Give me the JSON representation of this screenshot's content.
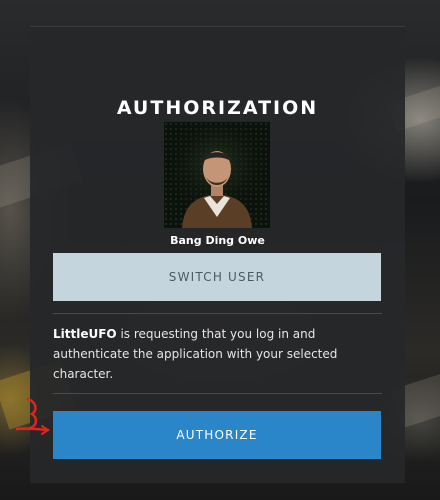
{
  "panel": {
    "title": "AUTHORIZATION",
    "character": {
      "name": "Bang Ding Owe"
    },
    "switch_user_label": "SWITCH USER",
    "description": {
      "app_name": "LittleUFO",
      "text": " is requesting that you log in and authenticate the application with your selected character."
    },
    "authorize_label": "AUTHORIZE"
  },
  "colors": {
    "panel_bg": "#262729",
    "switch_button": "#c5d5de",
    "authorize_button": "#2a86c8",
    "annotation": "#e0261c"
  },
  "icons": {
    "annotation_mark": "red-scribble-arrow"
  }
}
